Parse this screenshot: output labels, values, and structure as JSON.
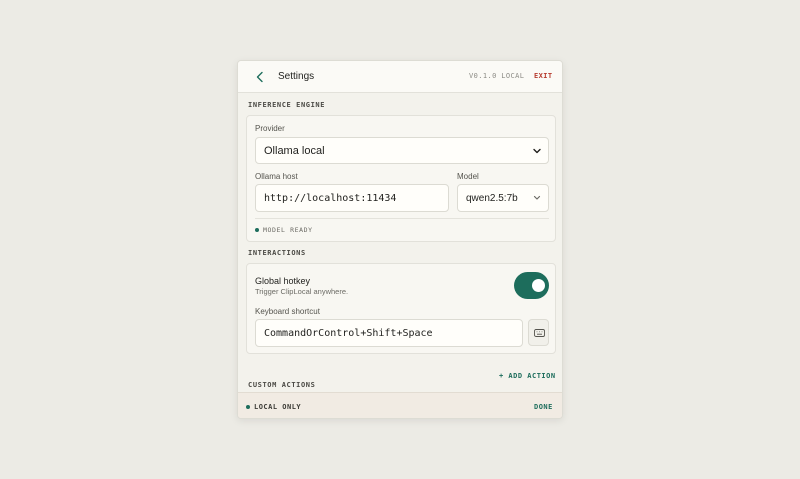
{
  "header": {
    "title": "Settings",
    "version": "V0.1.0 LOCAL",
    "exit_label": "EXIT"
  },
  "inference": {
    "section_title": "INFERENCE ENGINE",
    "provider_label": "Provider",
    "provider_value": "Ollama local",
    "host_label": "Ollama host",
    "host_value": "http://localhost:11434",
    "model_label": "Model",
    "model_value": "qwen2.5:7b",
    "status": "MODEL READY"
  },
  "interactions": {
    "section_title": "INTERACTIONS",
    "hotkey_title": "Global hotkey",
    "hotkey_subtitle": "Trigger ClipLocal anywhere.",
    "hotkey_enabled": true,
    "shortcut_label": "Keyboard shortcut",
    "shortcut_value": "CommandOrControl+Shift+Space"
  },
  "custom_actions": {
    "add_label": "+ ADD ACTION",
    "section_title": "CUSTOM ACTIONS"
  },
  "footer": {
    "status": "LOCAL ONLY",
    "done_label": "DONE"
  },
  "icons": {
    "back": "chevron-left-icon",
    "select": "chevron-down-icon",
    "keyboard": "keyboard-icon",
    "status_dot": "dot-icon"
  },
  "colors": {
    "accent": "#1d6d5c",
    "danger": "#b63a2e",
    "background": "#ecebe5",
    "panel": "#f3f2ec"
  }
}
